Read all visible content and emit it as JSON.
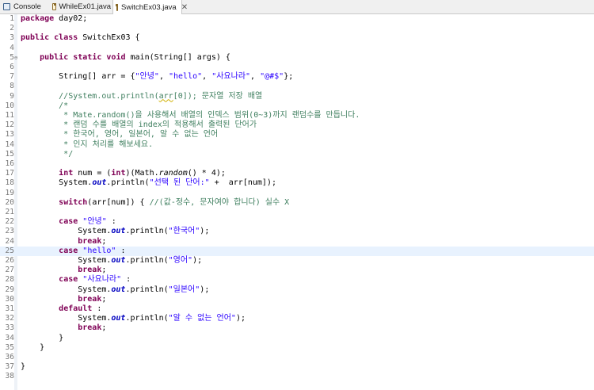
{
  "tabs": [
    {
      "label": "Console",
      "icon": "console-icon"
    },
    {
      "label": "WhileEx01.java",
      "icon": "java-file-icon"
    },
    {
      "label": "SwitchEx03.java",
      "icon": "java-file-icon",
      "active": true,
      "close": "✕"
    }
  ],
  "editor": {
    "current_line": 25,
    "lines": [
      {
        "n": "1",
        "code": "package day02;"
      },
      {
        "n": "2",
        "code": ""
      },
      {
        "n": "3",
        "code": "public class SwitchEx03 {"
      },
      {
        "n": "4",
        "code": ""
      },
      {
        "n": "5",
        "code": "    public static void main(String[] args) {",
        "fold": "⊖"
      },
      {
        "n": "6",
        "code": ""
      },
      {
        "n": "7",
        "code": "        String[] arr = {\"안녕\", \"hello\", \"사요나라\", \"@#$\"};"
      },
      {
        "n": "8",
        "code": ""
      },
      {
        "n": "9",
        "code": "        //System.out.println(arr[0]); 문자열 저장 배열"
      },
      {
        "n": "10",
        "code": "        /*"
      },
      {
        "n": "11",
        "code": "         * Mate.random()을 사용해서 배열의 인덱스 범위(0~3)까지 랜덤수를 만듭니다."
      },
      {
        "n": "12",
        "code": "         * 랜덤 수를 배열의 index의 적용해서 출력된 단어가"
      },
      {
        "n": "13",
        "code": "         * 한국어, 영어, 일본어, 알 수 없는 언어"
      },
      {
        "n": "14",
        "code": "         * 인지 처리를 해보세요."
      },
      {
        "n": "15",
        "code": "         */"
      },
      {
        "n": "16",
        "code": ""
      },
      {
        "n": "17",
        "code": "        int num = (int)(Math.random() * 4);"
      },
      {
        "n": "18",
        "code": "        System.out.println(\"선택 된 단어:\" +  arr[num]);"
      },
      {
        "n": "19",
        "code": ""
      },
      {
        "n": "20",
        "code": "        switch(arr[num]) { //(값-정수, 문자여야 합니다) 실수 X"
      },
      {
        "n": "21",
        "code": ""
      },
      {
        "n": "22",
        "code": "        case \"안녕\" :"
      },
      {
        "n": "23",
        "code": "            System.out.println(\"한국어\");"
      },
      {
        "n": "24",
        "code": "            break;"
      },
      {
        "n": "25",
        "code": "        case \"hello\" :"
      },
      {
        "n": "26",
        "code": "            System.out.println(\"영어\");"
      },
      {
        "n": "27",
        "code": "            break;"
      },
      {
        "n": "28",
        "code": "        case \"사요나라\" :"
      },
      {
        "n": "29",
        "code": "            System.out.println(\"일본어\");"
      },
      {
        "n": "30",
        "code": "            break;"
      },
      {
        "n": "31",
        "code": "        default :"
      },
      {
        "n": "32",
        "code": "            System.out.println(\"알 수 없는 언어\");"
      },
      {
        "n": "33",
        "code": "            break;"
      },
      {
        "n": "34",
        "code": "        }"
      },
      {
        "n": "35",
        "code": "    }"
      },
      {
        "n": "36",
        "code": ""
      },
      {
        "n": "37",
        "code": "}"
      },
      {
        "n": "38",
        "code": ""
      }
    ]
  },
  "colors": {
    "keyword": "#7f0055",
    "string": "#2a00ff",
    "comment": "#3f7f5f",
    "field": "#0000c0",
    "current_line": "#e8f2fe"
  }
}
